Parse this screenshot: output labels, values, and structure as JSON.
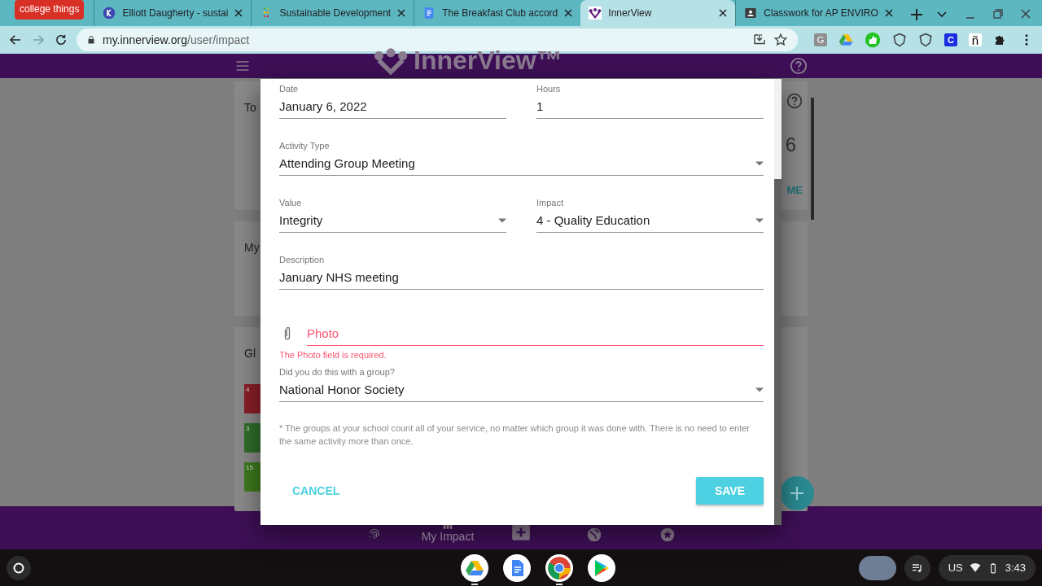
{
  "browser": {
    "tab_group": "college things",
    "tabs": [
      {
        "title": "Elliott Daugherty - sustai",
        "selected": false
      },
      {
        "title": "Sustainable Development",
        "selected": false
      },
      {
        "title": "The Breakfast Club accord",
        "selected": false
      },
      {
        "title": "InnerView",
        "selected": true
      },
      {
        "title": "Classwork for AP ENVIRO",
        "selected": false
      }
    ],
    "url_host": "my.innerview.org",
    "url_path": "/user/impact",
    "forward_disabled": true,
    "extensions": [
      {
        "kind": "letter",
        "label": "G"
      },
      {
        "kind": "drive"
      },
      {
        "kind": "thumb"
      },
      {
        "kind": "shield"
      },
      {
        "kind": "shield"
      },
      {
        "kind": "badge",
        "label": "C"
      },
      {
        "kind": "plain",
        "label": "ñ"
      },
      {
        "kind": "puzzle"
      }
    ]
  },
  "app": {
    "logo": "InnerView™",
    "cards": [
      {
        "title": "To",
        "value": "6",
        "link": "ME",
        "help": true
      },
      {
        "title": "My"
      },
      {
        "title": "Gl",
        "goals": [
          {
            "number": "4",
            "color": "#8a1e26"
          },
          {
            "number": "3",
            "color": "#2f6e2a"
          },
          {
            "number": "15",
            "color": "#3f7a1e"
          }
        ]
      }
    ],
    "nav": [
      {
        "selected": false
      },
      {
        "label": "My Impact",
        "selected": true
      },
      {
        "selected": false
      },
      {
        "selected": false
      },
      {
        "selected": false
      }
    ]
  },
  "dialog": {
    "rows": [
      [
        {
          "kind": "text",
          "label": "Date",
          "value": "January 6, 2022"
        },
        {
          "kind": "text",
          "label": "Hours",
          "value": "1"
        }
      ],
      [
        {
          "kind": "select",
          "label": "Activity Type",
          "value": "Attending Group Meeting"
        }
      ],
      [
        {
          "kind": "select",
          "label": "Value",
          "value": "Integrity"
        },
        {
          "kind": "select",
          "label": "Impact",
          "value": "4 - Quality Education"
        }
      ],
      [
        {
          "kind": "text",
          "label": "Description",
          "value": "January NHS meeting"
        }
      ],
      [
        {
          "kind": "file",
          "placeholder": "Photo",
          "invalid": true,
          "error": "The Photo field is required."
        }
      ],
      [
        {
          "kind": "select",
          "label": "Did you do this with a group?",
          "value": "National Honor Society"
        }
      ]
    ],
    "note": "* The groups at your school count all of your service, no matter which group it was done with. There is no need to enter the same activity more than once.",
    "buttons": [
      {
        "kind": "flat",
        "label": "CANCEL"
      },
      {
        "kind": "raised",
        "label": "SAVE"
      }
    ]
  },
  "taskbar": {
    "apps": [
      {
        "open": true
      },
      {
        "open": false
      },
      {
        "open": true
      },
      {
        "open": false
      }
    ],
    "ime": "US",
    "time": "3:43"
  }
}
